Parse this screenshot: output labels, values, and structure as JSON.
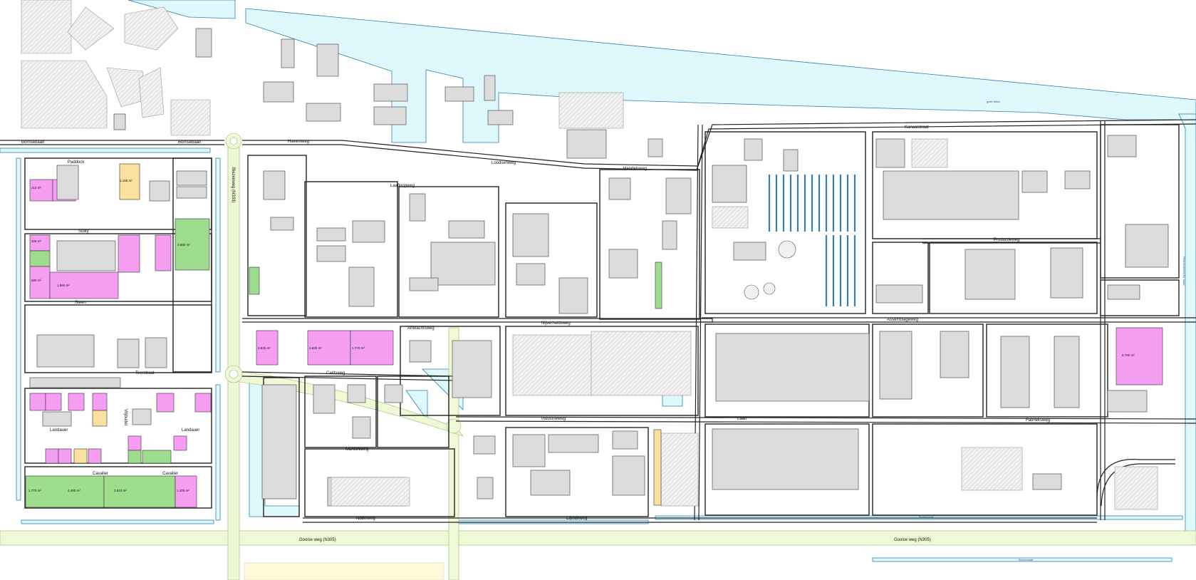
{
  "streets": {
    "bornsebaan_w": "Bornsebaan",
    "bornsebaan_e": "Bornsebaan",
    "biezenweg": "Biezenweg (N333)",
    "paddock": "Paddock",
    "sulky": "Sulky",
    "steen": "Steen",
    "teerstraat": "Teerstraat",
    "vrijbuiter": "Vrijbuiter",
    "landauer_w": "Landauer",
    "landauer_e": "Landauer",
    "cavalier_w": "Cavalier",
    "cavalier_e": "Cavalier",
    "haventweg": "Haventweg",
    "laafloopweg": "Laafloopweg",
    "loodsenweg": "Loodsenweg",
    "handelsweg": "Handelsweg",
    "industrieweg": "Industrieweg",
    "nijverheidsweg": "Nijverheidsweg",
    "ambachtsweg": "Ambachtsweg",
    "nobelweg": "Nobelweg",
    "edisonweg": "Edisonweg",
    "productieweg": "Productieweg",
    "assemblageweg": "Assemblageweg",
    "fabrieksweg": "Fabrieksweg",
    "kanaalstraat": "Kanaalstraat",
    "n305": "Gooise weg (N305)",
    "n305_e": "Gooise weg (N305)",
    "caidsweg": "Caidsweg",
    "marconiweg": "Marconiweg",
    "laan": "Laan"
  },
  "lot_areas": {
    "a1": "215 m²",
    "a2": "326 m²",
    "a3": "580 m²",
    "a4": "1.560 m²",
    "a5": "3.850 m²",
    "a6": "2.620 m²",
    "a7": "1.770 m²",
    "a8": "2.925 m²",
    "a9": "6.700 m²",
    "a10": "1.770 m²",
    "a11": "4.490 m²",
    "a12": "3.910 m²",
    "a13": "1.105 m²",
    "a14": "1.165 m²"
  },
  "water_labels": {
    "canal_north": "golfe Meer",
    "canal_south": "Bovenvaart",
    "canal_south_2": "Bovenvaart",
    "canal_east": "Heerenveensche Vaart"
  },
  "colors": {
    "water": "#dff8fb",
    "main_road": "#eff9d6",
    "building": "#dcdcdc",
    "lot_available": "#f59ef2",
    "lot_green": "#9edc8e",
    "lot_option": "#fbe1a0"
  }
}
